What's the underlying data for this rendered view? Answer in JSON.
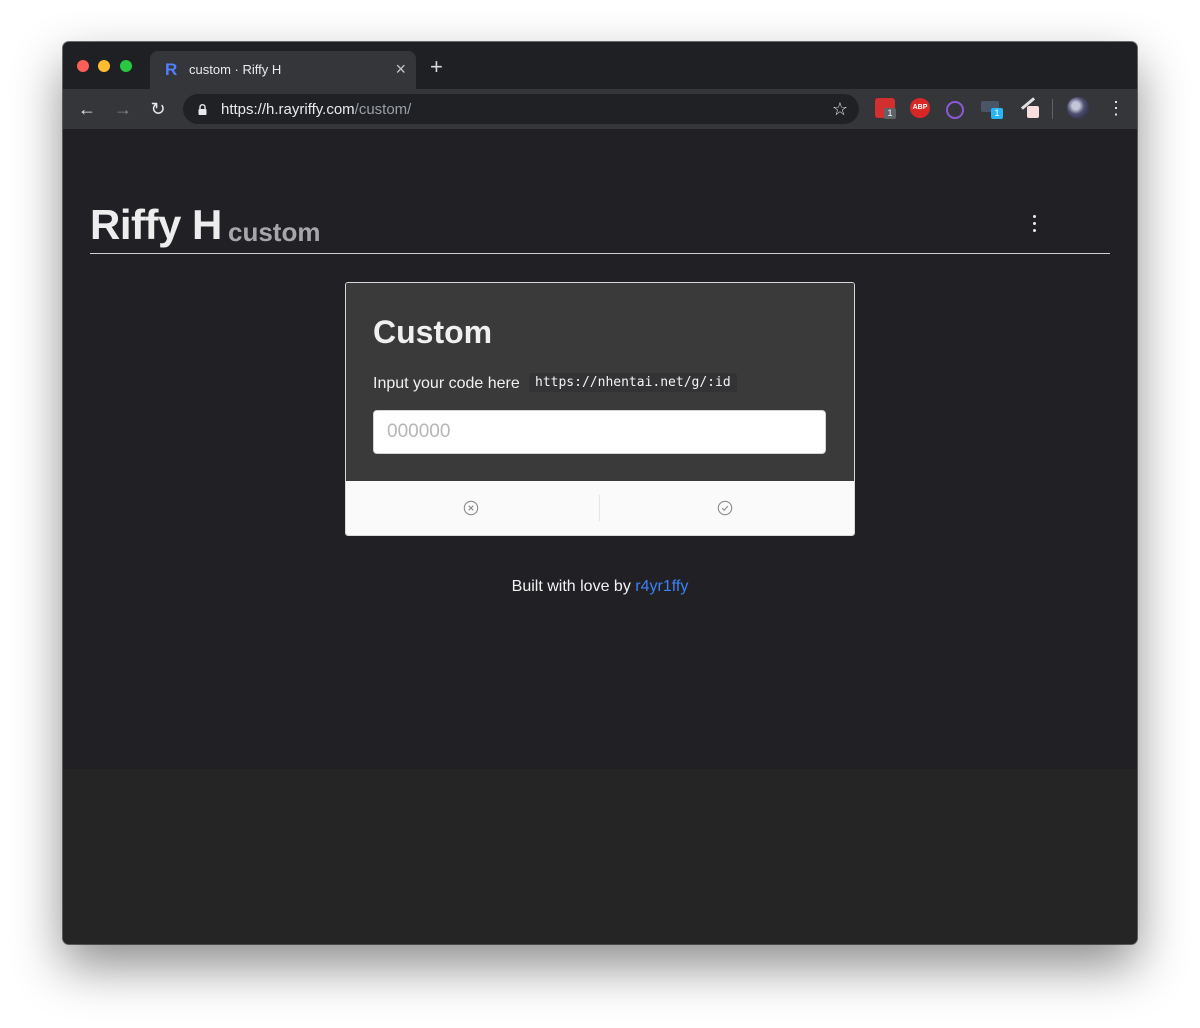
{
  "browser": {
    "tab": {
      "favicon": "R",
      "title": "custom · Riffy H"
    },
    "new_tab_label": "+",
    "address": {
      "host": "https://h.rayriffy.com",
      "path": "/custom/"
    },
    "extensions": {
      "lastpass_badge": "1",
      "abp_label": "ABP",
      "window_badge": "1"
    },
    "colors": {
      "tabstrip": "#1f2024",
      "toolbar": "#35363a",
      "omnibox": "#202124"
    }
  },
  "header": {
    "brand": "Riffy H",
    "subtitle": "custom"
  },
  "card": {
    "title": "Custom",
    "description": "Input your code here",
    "code_hint": "https://nhentai.net/g/:id",
    "input": {
      "placeholder": "000000",
      "value": ""
    }
  },
  "footer": {
    "text": "Built with love by",
    "link_text": "r4yr1ffy",
    "link_color": "#3b82f6"
  },
  "colors": {
    "page_bg": "#212125",
    "card_bg": "#3a3a3a",
    "card_footer": "#fafafa"
  }
}
